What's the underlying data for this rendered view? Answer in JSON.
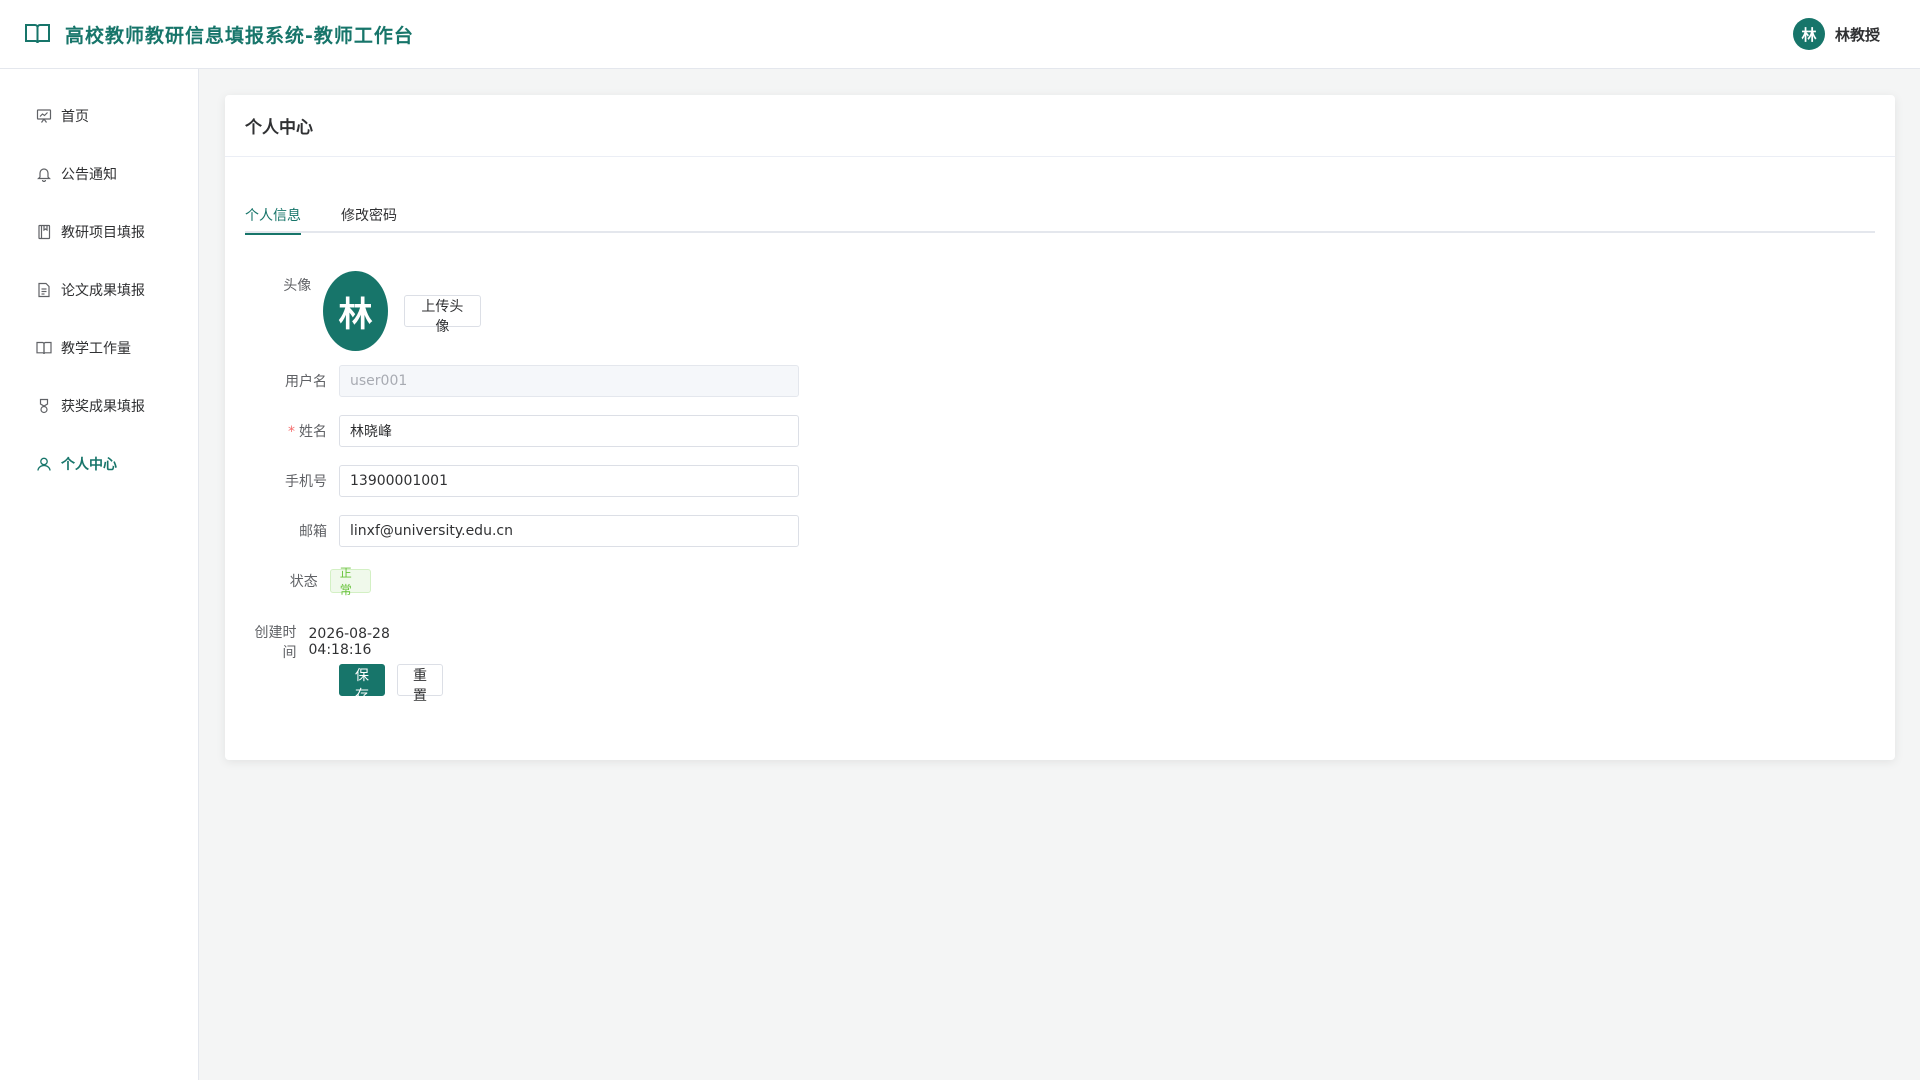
{
  "header": {
    "brand_icon": "book-open-icon",
    "title": "高校教师教研信息填报系统-教师工作台",
    "user": {
      "avatar_text": "林",
      "name": "林教授"
    }
  },
  "sidebar": {
    "items": [
      {
        "label": "首页",
        "icon": "dashboard-chart-icon",
        "active": false
      },
      {
        "label": "公告通知",
        "icon": "bell-icon",
        "active": false
      },
      {
        "label": "教研项目填报",
        "icon": "notebook-icon",
        "active": false
      },
      {
        "label": "论文成果填报",
        "icon": "document-icon",
        "active": false
      },
      {
        "label": "教学工作量",
        "icon": "book-icon",
        "active": false
      },
      {
        "label": "获奖成果填报",
        "icon": "medal-icon",
        "active": false
      },
      {
        "label": "个人中心",
        "icon": "user-icon",
        "active": true
      }
    ]
  },
  "page": {
    "title": "个人中心",
    "tabs": [
      {
        "label": "个人信息",
        "active": true
      },
      {
        "label": "修改密码",
        "active": false
      }
    ]
  },
  "form": {
    "avatar": {
      "label": "头像",
      "text": "林",
      "upload_label": "上传头像"
    },
    "username": {
      "label": "用户名",
      "value": "user001"
    },
    "name": {
      "label": "姓名",
      "required_mark": "*",
      "value": "林晓峰"
    },
    "phone": {
      "label": "手机号",
      "value": "13900001001"
    },
    "email": {
      "label": "邮箱",
      "value": "linxf@university.edu.cn"
    },
    "status": {
      "label": "状态",
      "value": "正常"
    },
    "created": {
      "label": "创建时间",
      "value": "2026-08-28 04:18:16"
    },
    "save_label": "保存修改",
    "reset_label": "重置"
  },
  "colors": {
    "primary": "#17756a",
    "success": "#67c23a",
    "danger": "#f56c6c"
  }
}
